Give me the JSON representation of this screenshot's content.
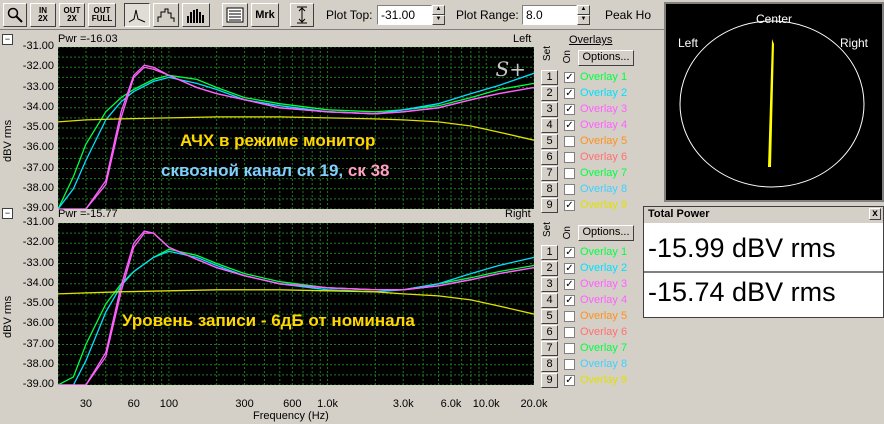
{
  "toolbar": {
    "zoom_in_2x": [
      "IN",
      "2X"
    ],
    "zoom_out_2x": [
      "OUT",
      "2X"
    ],
    "zoom_out_full": [
      "OUT",
      "FULL"
    ],
    "mrk_label": "Mrk",
    "plot_top_label": "Plot Top:",
    "plot_top_value": "-31.00",
    "plot_range_label": "Plot Range:",
    "plot_range_value": "8.0",
    "peak_hold_label": "Peak Ho"
  },
  "top_panel": {
    "pwr": "Pwr =-16.03",
    "channel": "Left",
    "annotation_line1": "АЧХ в режиме монитор",
    "annotation_line2a": "сквозной канал ск 19,",
    "annotation_line2b": " ск 38",
    "watermark": "S+"
  },
  "bottom_panel": {
    "pwr": "Pwr =-15.77",
    "channel": "Right",
    "annotation": "Уровень записи - 6дБ от номинала"
  },
  "y_axis": {
    "label": "dBV rms",
    "ticks": [
      "-31.00",
      "-32.00",
      "-33.00",
      "-34.00",
      "-35.00",
      "-36.00",
      "-37.00",
      "-38.00",
      "-39.00"
    ]
  },
  "x_axis": {
    "label": "Frequency (Hz)",
    "ticks": [
      {
        "label": "30",
        "f": 30
      },
      {
        "label": "60",
        "f": 60
      },
      {
        "label": "100",
        "f": 100
      },
      {
        "label": "300",
        "f": 300
      },
      {
        "label": "600",
        "f": 600
      },
      {
        "label": "1.0k",
        "f": 1000
      },
      {
        "label": "3.0k",
        "f": 3000
      },
      {
        "label": "6.0k",
        "f": 6000
      },
      {
        "label": "10.0k",
        "f": 10000
      },
      {
        "label": "20.0k",
        "f": 20000
      }
    ]
  },
  "overlays": {
    "title": "Overlays",
    "options_label": "Options...",
    "set_label": "Set",
    "on_label": "On",
    "top_items": [
      {
        "num": "1",
        "label": "Overlay 1",
        "checked": true,
        "color": "#00ff40"
      },
      {
        "num": "2",
        "label": "Overlay 2",
        "checked": true,
        "color": "#00e0ff"
      },
      {
        "num": "3",
        "label": "Overlay 3",
        "checked": true,
        "color": "#ff60ff"
      },
      {
        "num": "4",
        "label": "Overlay 4",
        "checked": true,
        "color": "#ff60ff"
      },
      {
        "num": "5",
        "label": "Overlay 5",
        "checked": false,
        "color": "#ff9020"
      },
      {
        "num": "6",
        "label": "Overlay 6",
        "checked": false,
        "color": "#ff7070"
      },
      {
        "num": "7",
        "label": "Overlay 7",
        "checked": false,
        "color": "#00ff40"
      },
      {
        "num": "8",
        "label": "Overlay 8",
        "checked": false,
        "color": "#40d0ff"
      },
      {
        "num": "9",
        "label": "Overlay 9",
        "checked": true,
        "color": "#e0e000"
      }
    ],
    "bottom_items": [
      {
        "num": "1",
        "label": "Overlay 1",
        "checked": true,
        "color": "#00ff40"
      },
      {
        "num": "2",
        "label": "Overlay 2",
        "checked": true,
        "color": "#00e0ff"
      },
      {
        "num": "3",
        "label": "Overlay 3",
        "checked": true,
        "color": "#ff60ff"
      },
      {
        "num": "4",
        "label": "Overlay 4",
        "checked": true,
        "color": "#ff60ff"
      },
      {
        "num": "5",
        "label": "Overlay 5",
        "checked": false,
        "color": "#ff9020"
      },
      {
        "num": "6",
        "label": "Overlay 6",
        "checked": false,
        "color": "#ff7070"
      },
      {
        "num": "7",
        "label": "Overlay 7",
        "checked": false,
        "color": "#00ff40"
      },
      {
        "num": "8",
        "label": "Overlay 8",
        "checked": false,
        "color": "#40d0ff"
      },
      {
        "num": "9",
        "label": "Overlay 9",
        "checked": true,
        "color": "#e0e000"
      }
    ]
  },
  "phase_scope": {
    "center_label": "Center",
    "left_label": "Left",
    "right_label": "Right"
  },
  "total_power": {
    "title": "Total Power",
    "close_label": "x",
    "value_left": "-15.99 dBV rms",
    "value_right": "-15.74 dBV rms"
  },
  "chart_data": [
    {
      "type": "line",
      "xscale": "log",
      "xlim": [
        20,
        20000
      ],
      "ylim": [
        -39,
        -31
      ],
      "xlabel": "Frequency (Hz)",
      "ylabel": "dBV rms",
      "series": [
        {
          "name": "Overlay 1",
          "color": "#00ff40",
          "x": [
            20,
            25,
            30,
            40,
            50,
            60,
            80,
            100,
            150,
            200,
            300,
            500,
            1000,
            2000,
            3000,
            5000,
            8000,
            12000,
            20000
          ],
          "y": [
            -39,
            -37.4,
            -35.8,
            -34.2,
            -33.5,
            -33.1,
            -32.6,
            -32.4,
            -32.6,
            -33,
            -33.5,
            -33.8,
            -34.1,
            -34.2,
            -34.1,
            -33.9,
            -33.5,
            -33.1,
            -32.8
          ]
        },
        {
          "name": "Overlay 2",
          "color": "#00e0ff",
          "x": [
            20,
            25,
            30,
            40,
            50,
            60,
            80,
            100,
            150,
            200,
            300,
            500,
            1000,
            2000,
            3000,
            5000,
            8000,
            12000,
            20000
          ],
          "y": [
            -39,
            -38,
            -36.6,
            -34.6,
            -33.7,
            -33.2,
            -32.7,
            -32.5,
            -32.8,
            -33.1,
            -33.6,
            -33.9,
            -34.2,
            -34.3,
            -34.1,
            -33.8,
            -33.3,
            -32.9,
            -32.3
          ]
        },
        {
          "name": "Overlay 3",
          "color": "#ff60ff",
          "x": [
            20,
            30,
            40,
            50,
            60,
            70,
            80,
            100,
            150,
            200,
            300,
            500,
            1000,
            2000,
            3000,
            5000,
            8000,
            12000,
            20000
          ],
          "y": [
            -39,
            -39,
            -37.8,
            -34.5,
            -32.5,
            -32,
            -32.1,
            -32.4,
            -33,
            -33.3,
            -33.6,
            -34,
            -34.2,
            -34.3,
            -34.2,
            -34,
            -33.6,
            -33.3,
            -33
          ]
        },
        {
          "name": "Overlay 4",
          "color": "#ff60ff",
          "x": [
            20,
            30,
            40,
            50,
            60,
            70,
            80,
            100,
            150,
            200,
            300,
            500,
            1000,
            2000,
            3000,
            5000,
            8000,
            12000,
            20000
          ],
          "y": [
            -39,
            -39,
            -37.6,
            -34.2,
            -32.4,
            -31.9,
            -32,
            -32.4,
            -33,
            -33.3,
            -33.6,
            -34,
            -34.2,
            -34.3,
            -34.2,
            -34,
            -33.6,
            -33.3,
            -33
          ]
        },
        {
          "name": "Overlay 9",
          "color": "#e0e000",
          "x": [
            20,
            30,
            50,
            100,
            200,
            500,
            1000,
            2000,
            3000,
            5000,
            8000,
            12000,
            20000
          ],
          "y": [
            -34.7,
            -34.6,
            -34.55,
            -34.5,
            -34.45,
            -34.45,
            -34.5,
            -34.55,
            -34.6,
            -34.7,
            -34.9,
            -35.2,
            -35.6
          ]
        }
      ]
    },
    {
      "type": "line",
      "xscale": "log",
      "xlim": [
        20,
        20000
      ],
      "ylim": [
        -39,
        -31
      ],
      "xlabel": "Frequency (Hz)",
      "ylabel": "dBV rms",
      "series": [
        {
          "name": "Overlay 1",
          "color": "#00ff40",
          "x": [
            20,
            25,
            30,
            40,
            50,
            60,
            80,
            100,
            150,
            200,
            300,
            500,
            1000,
            2000,
            3000,
            5000,
            8000,
            12000,
            20000
          ],
          "y": [
            -39,
            -38.6,
            -37,
            -35,
            -34,
            -33.4,
            -32.7,
            -32.3,
            -32.6,
            -33,
            -33.5,
            -33.9,
            -34.2,
            -34.3,
            -34.3,
            -34,
            -33.7,
            -33.4,
            -33.1
          ]
        },
        {
          "name": "Overlay 2",
          "color": "#00e0ff",
          "x": [
            20,
            25,
            30,
            40,
            50,
            60,
            80,
            100,
            150,
            200,
            300,
            500,
            1000,
            2000,
            3000,
            5000,
            8000,
            12000,
            20000
          ],
          "y": [
            -39,
            -39,
            -37.8,
            -35.4,
            -34.1,
            -33.4,
            -32.7,
            -32.4,
            -32.7,
            -33.1,
            -33.6,
            -34,
            -34.3,
            -34.4,
            -34.3,
            -34,
            -33.5,
            -33.1,
            -32.7
          ]
        },
        {
          "name": "Overlay 3",
          "color": "#ff60ff",
          "x": [
            20,
            30,
            40,
            50,
            60,
            70,
            80,
            100,
            150,
            200,
            300,
            500,
            1000,
            2000,
            3000,
            5000,
            8000,
            12000,
            20000
          ],
          "y": [
            -39,
            -39,
            -37.6,
            -34.4,
            -32.2,
            -31.5,
            -31.5,
            -32.2,
            -32.8,
            -33.2,
            -33.6,
            -34,
            -34.2,
            -34.3,
            -34.3,
            -34.1,
            -33.8,
            -33.5,
            -33.2
          ]
        },
        {
          "name": "Overlay 4",
          "color": "#ff60ff",
          "x": [
            20,
            30,
            40,
            50,
            60,
            70,
            80,
            100,
            150,
            200,
            300,
            500,
            1000,
            2000,
            3000,
            5000,
            8000,
            12000,
            20000
          ],
          "y": [
            -39,
            -39,
            -37.4,
            -34.1,
            -32,
            -31.4,
            -31.5,
            -32.2,
            -32.8,
            -33.2,
            -33.6,
            -34,
            -34.2,
            -34.3,
            -34.3,
            -34.1,
            -33.8,
            -33.5,
            -33.2
          ]
        },
        {
          "name": "Overlay 9",
          "color": "#e0e000",
          "x": [
            20,
            30,
            50,
            100,
            200,
            500,
            1000,
            2000,
            3000,
            5000,
            8000,
            12000,
            20000
          ],
          "y": [
            -34.5,
            -34.45,
            -34.4,
            -34.35,
            -34.3,
            -34.3,
            -34.35,
            -34.4,
            -34.5,
            -34.6,
            -34.8,
            -35.1,
            -35.5
          ]
        }
      ]
    }
  ]
}
